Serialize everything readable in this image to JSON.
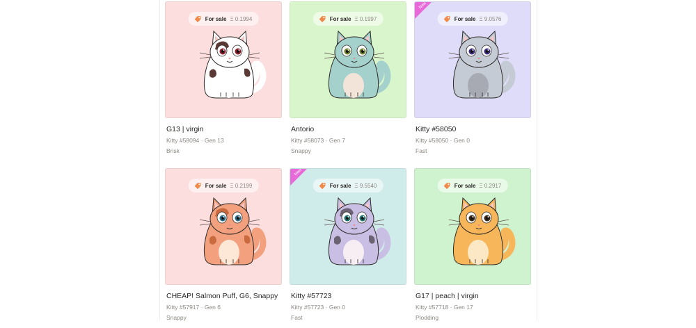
{
  "cards": [
    {
      "title": "G13 | virgin",
      "kitty": "Kitty #58094",
      "gen": "Gen 13",
      "speed": "Brisk",
      "sale_label": "For sale",
      "price": "Ξ 0.1994",
      "new": false,
      "bg": "#fcdede",
      "cat_color": "#ffffff",
      "patch_color": "#5b3a36",
      "tail_color": "#ffffff",
      "belly_color": "#ffffff",
      "eye_color": "#8a1f2b"
    },
    {
      "title": "Antorio",
      "kitty": "Kitty #58073",
      "gen": "Gen 7",
      "speed": "Snappy",
      "sale_label": "For sale",
      "price": "Ξ 0.1997",
      "new": false,
      "bg": "#d9f5cb",
      "cat_color": "#a5d1cc",
      "patch_color": "#a5d1cc",
      "tail_color": "#a5d1cc",
      "belly_color": "#f3e4da",
      "eye_color": "#6b7d2c"
    },
    {
      "title": "Kitty #58050",
      "kitty": "Kitty #58050",
      "gen": "Gen 0",
      "speed": "Fast",
      "sale_label": "For sale",
      "price": "Ξ 9.0576",
      "new": true,
      "new_label": "New",
      "bg": "#dedcf9",
      "cat_color": "#c5cbd4",
      "patch_color": "#c5cbd4",
      "tail_color": "#c5cbd4",
      "belly_color": "#a7a9b3",
      "eye_color": "#3b2c7a"
    },
    {
      "title": "CHEAP! Salmon Puff, G6, Snappy",
      "kitty": "Kitty #57917",
      "gen": "Gen 6",
      "speed": "Snappy",
      "sale_label": "For sale",
      "price": "Ξ 0.2199",
      "new": false,
      "bg": "#fcdede",
      "cat_color": "#f2a07e",
      "patch_color": "#c96a3e",
      "tail_color": "#f2a07e",
      "belly_color": "#fde7d6",
      "eye_color": "#2c6a86"
    },
    {
      "title": "Kitty #57723",
      "kitty": "Kitty #57723",
      "gen": "Gen 0",
      "speed": "Fast",
      "sale_label": "For sale",
      "price": "Ξ 9.5540",
      "new": true,
      "new_label": "New",
      "bg": "#cfecea",
      "cat_color": "#c9bfe4",
      "patch_color": "#6b6373",
      "tail_color": "#c9bfe4",
      "belly_color": "#f6eef2",
      "eye_color": "#1f6f6b"
    },
    {
      "title": "G17 | peach | virgin",
      "kitty": "Kitty #57718",
      "gen": "Gen 17",
      "speed": "Plodding",
      "sale_label": "For sale",
      "price": "Ξ 0.2917",
      "new": false,
      "bg": "#cff3cf",
      "cat_color": "#f7b65a",
      "patch_color": "#f7b65a",
      "tail_color": "#f7b65a",
      "belly_color": "#fde8c6",
      "eye_color": "#3b2a1a"
    }
  ],
  "colors": {
    "ribbon": "#e86ad8",
    "text_dark": "#2a2825",
    "text_muted": "#8c8781"
  },
  "icons": {
    "price_tag": "price-tag-icon",
    "new_ribbon": "new-ribbon-badge",
    "cat_art": "cat-illustration"
  }
}
